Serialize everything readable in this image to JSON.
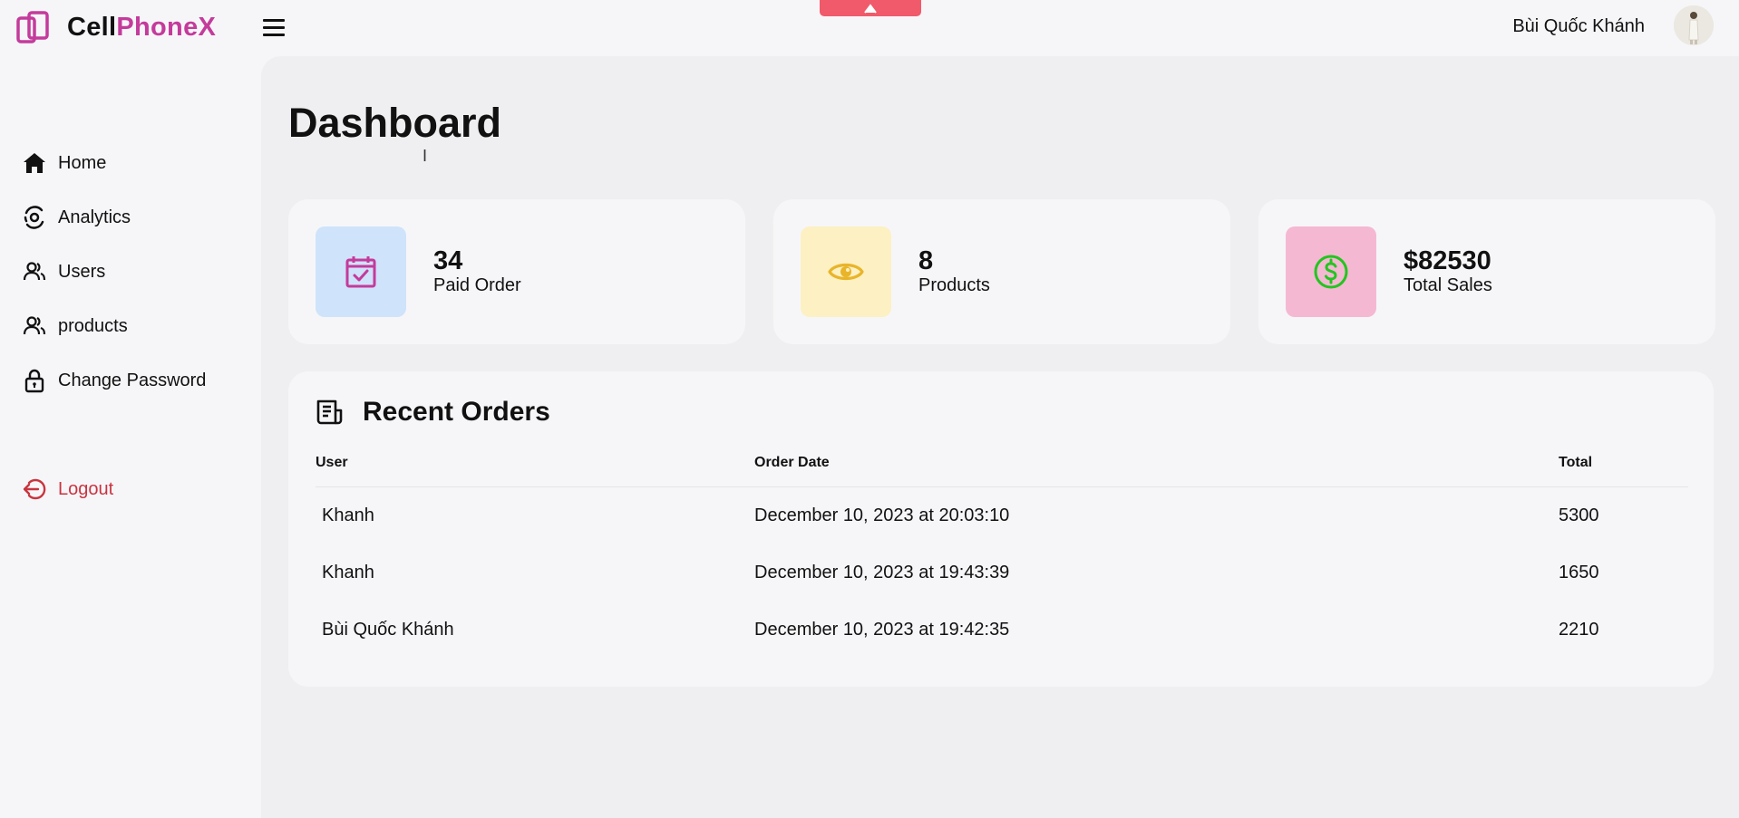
{
  "brand": {
    "part1": "Cell",
    "part2": "PhoneX"
  },
  "header": {
    "user_name": "Bùi Quốc Khánh"
  },
  "sidebar": {
    "items": [
      {
        "label": "Home",
        "icon": "home-icon"
      },
      {
        "label": "Analytics",
        "icon": "analytics-icon"
      },
      {
        "label": "Users",
        "icon": "users-icon"
      },
      {
        "label": "products",
        "icon": "products-icon"
      },
      {
        "label": "Change Password",
        "icon": "lock-icon"
      }
    ],
    "logout": "Logout"
  },
  "main": {
    "title": "Dashboard"
  },
  "cards": [
    {
      "value": "34",
      "label": "Paid Order",
      "icon": "calendar-check-icon",
      "color": "#cfe3fb",
      "icon_color": "#c43b9b"
    },
    {
      "value": "8",
      "label": "Products",
      "icon": "eye-icon",
      "color": "#fdf0c2",
      "icon_color": "#e8b52a"
    },
    {
      "value": "$82530",
      "label": "Total Sales",
      "icon": "dollar-icon",
      "color": "#f5b8d2",
      "icon_color": "#22c51f"
    }
  ],
  "orders": {
    "title": "Recent Orders",
    "columns": [
      "User",
      "Order Date",
      "Total"
    ],
    "rows": [
      {
        "user": "Khanh",
        "date": "December 10, 2023 at 20:03:10",
        "total": "5300"
      },
      {
        "user": "Khanh",
        "date": "December 10, 2023 at 19:43:39",
        "total": "1650"
      },
      {
        "user": "Bùi Quốc Khánh",
        "date": "December 10, 2023 at 19:42:35",
        "total": "2210"
      }
    ]
  },
  "colors": {
    "accent": "#c43b9b",
    "logout": "#c9343f",
    "top_tab": "#f05a6a"
  }
}
